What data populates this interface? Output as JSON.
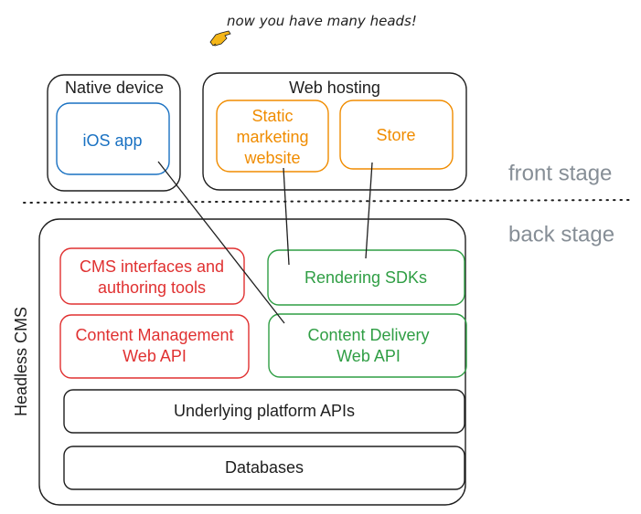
{
  "annotation": {
    "text": "now you have many heads!",
    "icon": "pointing-hand-icon",
    "icon_color": "#f5b617"
  },
  "stages": {
    "front": "front stage",
    "back": "back stage",
    "color": "#868e96"
  },
  "front_stage": {
    "native_device": {
      "title": "Native device",
      "children": [
        {
          "label": "iOS app",
          "color": "#1971c2"
        }
      ]
    },
    "web_hosting": {
      "title": "Web hosting",
      "children": [
        {
          "label_lines": [
            "Static",
            "marketing",
            "website"
          ],
          "color": "#f08c00"
        },
        {
          "label": "Store",
          "color": "#f08c00"
        }
      ]
    }
  },
  "headless_cms": {
    "title": "Headless CMS",
    "management_side": {
      "color": "#e03131",
      "items": [
        {
          "label_lines": [
            "CMS interfaces and",
            "authoring tools"
          ]
        },
        {
          "label_lines": [
            "Content Management",
            "Web API"
          ]
        }
      ]
    },
    "delivery_side": {
      "color": "#2f9e44",
      "items": [
        {
          "label_lines": [
            "Rendering SDKs"
          ]
        },
        {
          "label_lines": [
            "Content Delivery",
            "Web API"
          ]
        }
      ]
    },
    "platform_layers": [
      {
        "label": "Underlying platform APIs"
      },
      {
        "label": "Databases"
      }
    ]
  },
  "connections": [
    {
      "from": "iOS app",
      "to": "Content Delivery Web API"
    },
    {
      "from": "Static marketing website",
      "to": "Rendering SDKs"
    },
    {
      "from": "Store",
      "to": "Rendering SDKs"
    }
  ]
}
